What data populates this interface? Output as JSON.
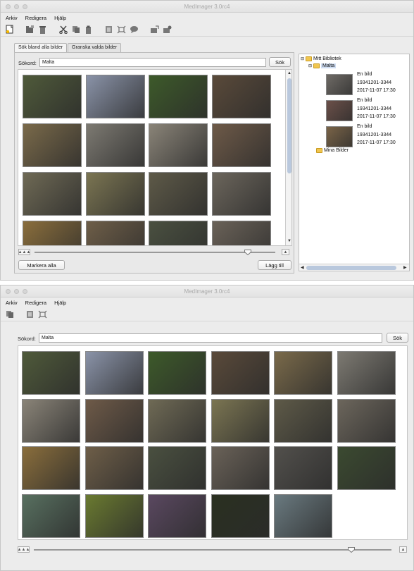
{
  "app": {
    "title": "MedImager 3.0rc4"
  },
  "menu": [
    "Arkiv",
    "Redigera",
    "Hjälp"
  ],
  "w1": {
    "tabs": [
      "Sök bland alla bilder",
      "Granska valda bilder"
    ],
    "search": {
      "label": "Sökord:",
      "value": "Malta",
      "button": "Sök"
    },
    "select_all_button": "Markera alla",
    "add_button": "Lägg till",
    "thumbs": [
      "#4f5a3a",
      "#8a93a8",
      "#3d5a2a",
      "#5a4a3a",
      "#7a6a4a",
      "#7d7a72",
      "#8a8478",
      "#6e5a48",
      "#6f6a55",
      "#7b7552",
      "#5e5a48",
      "#6c665c",
      "#8a6e3c",
      "#6e5e48",
      "#4a5040",
      "#6a6258"
    ],
    "tree": {
      "root": "Mitt Bibliotek",
      "child": "Malta",
      "leaves": [
        {
          "l1": "En bild",
          "l2": "19341201-3344",
          "l3": "2017-11-07 17:30",
          "color": "#6f6b66"
        },
        {
          "l1": "En bild",
          "l2": "19341201-3344",
          "l3": "2017-11-07 17:30",
          "color": "#6b5049"
        },
        {
          "l1": "En bild",
          "l2": "19341201-3344",
          "l3": "2017-11-07 17:30",
          "color": "#7a6448"
        }
      ],
      "sibling": "Mina Bilder"
    }
  },
  "w2": {
    "search": {
      "label": "Sökord:",
      "value": "Malta",
      "button": "Sök"
    },
    "thumbs": [
      "#4f5a3a",
      "#8a93a8",
      "#3d5a2a",
      "#5a4a3a",
      "#7a6a4a",
      "#7d7a72",
      "#8a8478",
      "#6e5a48",
      "#6f6a55",
      "#7b7552",
      "#5e5a48",
      "#6c665c",
      "#8a6e3c",
      "#6e5e48",
      "#4a5040",
      "#6a6258",
      "#52504c",
      "#3b4a30",
      "#587060",
      "#6a7a30",
      "#5a4860",
      "#2a3020",
      "#6a7a80"
    ]
  }
}
